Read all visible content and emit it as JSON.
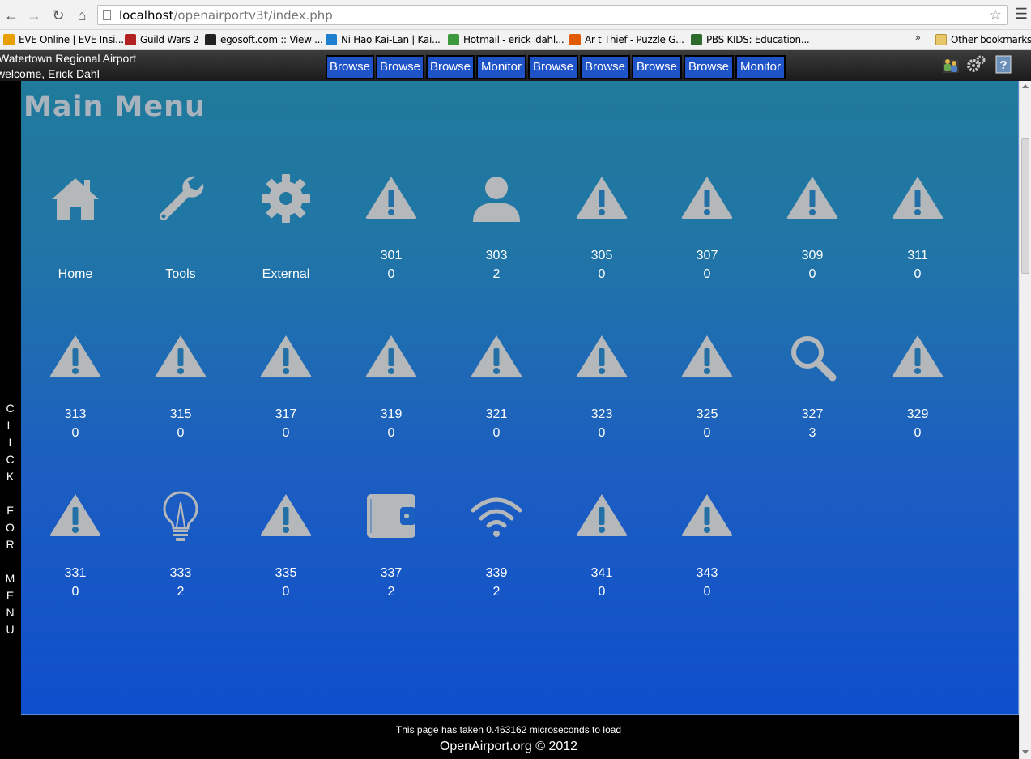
{
  "browser": {
    "url_host": "localhost",
    "url_path": "/openairportv3t/index.php",
    "bookmarks": [
      {
        "label": "EVE Online | EVE Insi...",
        "color": "#e8a000"
      },
      {
        "label": "Guild Wars 2",
        "color": "#b22222"
      },
      {
        "label": "egosoft.com :: View ...",
        "color": "#222222"
      },
      {
        "label": "Ni Hao Kai-Lan | Kai...",
        "color": "#1e7fd0"
      },
      {
        "label": "Hotmail - erick_dahl...",
        "color": "#3c9a3c"
      },
      {
        "label": "Ar t Thief - Puzzle G...",
        "color": "#e05a00"
      },
      {
        "label": "PBS KIDS: Education...",
        "color": "#2d6b2d"
      }
    ],
    "more_label": "»",
    "other_bookmarks": "Other bookmarks"
  },
  "header": {
    "airport": "Watertown Regional Airport",
    "welcome": "welcome, Erick Dahl",
    "tabs": [
      "Browse",
      "Browse",
      "Browse",
      "Monitor",
      "Browse",
      "Browse",
      "Browse",
      "Browse",
      "Monitor"
    ],
    "icons": [
      "users-icon",
      "gears-icon",
      "help-icon"
    ]
  },
  "left_menu": {
    "text": [
      "C",
      "L",
      "I",
      "C",
      "K",
      "",
      "F",
      "O",
      "R",
      "",
      "M",
      "E",
      "N",
      "U"
    ]
  },
  "main": {
    "title": "Main Menu",
    "rows": [
      [
        {
          "icon": "home-icon",
          "label": "Home"
        },
        {
          "icon": "wrench-icon",
          "label": "Tools"
        },
        {
          "icon": "gear-icon",
          "label": "External"
        },
        {
          "icon": "warning-icon",
          "num": "301",
          "count": "0"
        },
        {
          "icon": "user-icon",
          "num": "303",
          "count": "2"
        },
        {
          "icon": "warning-icon",
          "num": "305",
          "count": "0"
        },
        {
          "icon": "warning-icon",
          "num": "307",
          "count": "0"
        },
        {
          "icon": "warning-icon",
          "num": "309",
          "count": "0"
        },
        {
          "icon": "warning-icon",
          "num": "311",
          "count": "0"
        }
      ],
      [
        {
          "icon": "warning-icon",
          "num": "313",
          "count": "0"
        },
        {
          "icon": "warning-icon",
          "num": "315",
          "count": "0"
        },
        {
          "icon": "warning-icon",
          "num": "317",
          "count": "0"
        },
        {
          "icon": "warning-icon",
          "num": "319",
          "count": "0"
        },
        {
          "icon": "warning-icon",
          "num": "321",
          "count": "0"
        },
        {
          "icon": "warning-icon",
          "num": "323",
          "count": "0"
        },
        {
          "icon": "warning-icon",
          "num": "325",
          "count": "0"
        },
        {
          "icon": "search-icon",
          "num": "327",
          "count": "3"
        },
        {
          "icon": "warning-icon",
          "num": "329",
          "count": "0"
        }
      ],
      [
        {
          "icon": "warning-icon",
          "num": "331",
          "count": "0"
        },
        {
          "icon": "lightbulb-icon",
          "num": "333",
          "count": "2"
        },
        {
          "icon": "warning-icon",
          "num": "335",
          "count": "0"
        },
        {
          "icon": "wallet-icon",
          "num": "337",
          "count": "2"
        },
        {
          "icon": "wifi-icon",
          "num": "339",
          "count": "2"
        },
        {
          "icon": "warning-icon",
          "num": "341",
          "count": "0"
        },
        {
          "icon": "warning-icon",
          "num": "343",
          "count": "0"
        }
      ]
    ]
  },
  "footer": {
    "load_text": "This page has taken 0.463162 microseconds to load",
    "copyright": "OpenAirport.org © 2012"
  },
  "colors": {
    "icon_gray": "#b5b8bb",
    "tab_blue": "#1f54c8"
  }
}
